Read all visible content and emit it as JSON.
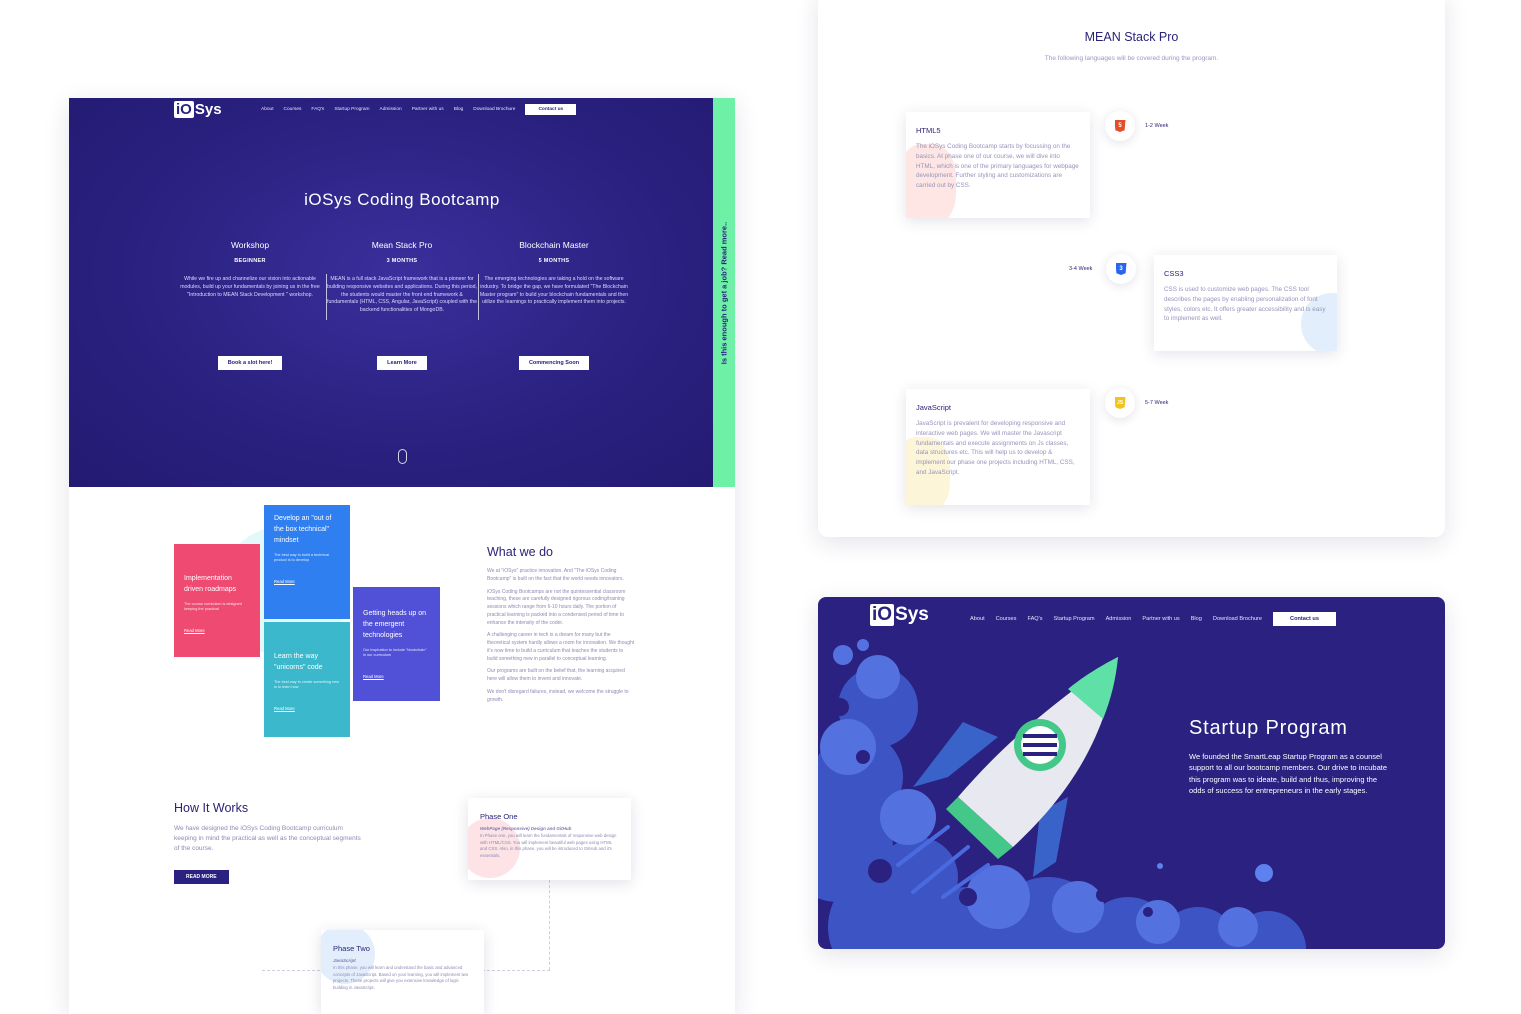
{
  "brand": {
    "logo_mark": "iO",
    "logo_rest": "Sys"
  },
  "nav": {
    "items": [
      "About",
      "Courses",
      "FAQ's",
      "Startup Program",
      "Admission",
      "Partner with us",
      "Blog",
      "Download Brochure"
    ],
    "contact_label": "Contact us"
  },
  "hero": {
    "title": "iOSys Coding Bootcamp",
    "side_tab": "Is this enough to get a job? Read more..",
    "programs": [
      {
        "name": "Workshop",
        "level": "BEGINNER",
        "description": "While we fire up and channelize our vision into actionable modules, build up your fundamentals by joining us in the free \"Introduction to MEAN Stack Development \" workshop.",
        "button": "Book a slot here!"
      },
      {
        "name": "Mean Stack Pro",
        "level": "3 MONTHS",
        "description": "MEAN is a full stack JavaScript framework that is a pioneer for building responsive websites and applications. During this period, the students would master the front end framework & fundamentals (HTML, CSS, Angular, JavaScript) coupled with the backend functionalities of MongoDB.",
        "button": "Learn More"
      },
      {
        "name": "Blockchain Master",
        "level": "5 MONTHS",
        "description": "The emerging technologies are taking a hold on the software industry. To bridge the gap, we have formulated \"The Blockchain Master program\" to build your blockchain fundamentals and then utilize the learnings to practically implement them into projects.",
        "button": "Commencing Soon"
      }
    ]
  },
  "cards": [
    {
      "title": "Implementation driven roadmaps",
      "text": "The course curriculum is designed keeping the practical",
      "link": "Read More",
      "color": "#ee4a72"
    },
    {
      "title": "Develop an \"out of the box technical\" mindset",
      "text": "The best way to build a technical product is to develop",
      "link": "Read More",
      "color": "#2f7ff0"
    },
    {
      "title": "Learn the way \"unicorns\" code",
      "text": "The best way to create something new is to learn how",
      "link": "Read More",
      "color": "#3bb8cc"
    },
    {
      "title": "Getting heads up on the emergent technologies",
      "text": "Our inspiration to include \"blockchain\" in our curriculum",
      "link": "Read More",
      "color": "#5151d8"
    }
  ],
  "what_we_do": {
    "title": "What we do",
    "paragraphs": [
      "We at \"iOSys\" practice innovation. And \"The iOSys Coding Bootcamp\" is built on the fact that the world needs innovators.",
      "iOSys Coding Bootcamps are not the quintessential classroom teaching, these are carefully designed rigorous coding/training sessions which range from 6-10 hours daily. The portion of practical learning is packed into a condensed period of time to enhance the intensity of the coder.",
      "A challenging career in tech is a dream for many but the theoretical system hardly allows a room for innovation. We thought it's now time to build a curriculum that teaches the students to build something new in parallel to conceptual learning.",
      "Our programs are built on the belief that, the learning acquired here will allow them to invent and innovate.",
      "We don't disregard failures, instead, we welcome the struggle to growth."
    ]
  },
  "how_it_works": {
    "title": "How It Works",
    "text": "We have designed the iOSys Coding Bootcamp curriculum keeping in mind the practical as well as the conceptual segments of the course.",
    "button": "READ MORE"
  },
  "phases": [
    {
      "title": "Phase One",
      "topic": "WebPage (Responsive) Design and GitHub",
      "text": "In Phase one, you will learn the fundamentals of responsive web design with HTML/CSS. You will implement beautiful web pages using HTML and CSS. Also, in this phase, you will be introduced to GitHub and it's essentials."
    },
    {
      "title": "Phase Two",
      "topic": "JavaScript",
      "text": "In this phase, you will learn and understand the basic and advanced concepts of JavaScript. Based on your learning, you will implement two projects. These projects will give you extensive knowledge of logic building in JavaScript."
    }
  ],
  "mean_stack": {
    "title": "MEAN Stack Pro",
    "subtitle": "The following languages will be covered during the program.",
    "languages": [
      {
        "name": "HTML5",
        "text": "The iOSys Coding Bootcamp starts by focussing on the basics. At phase one of our course, we will dive into HTML, which is one of the primary languages for webpage development. Further styling and customizations are carried out by CSS.",
        "duration": "1-2 Week",
        "icon": "html5-icon",
        "badge": "5",
        "color": "#e44d26"
      },
      {
        "name": "CSS3",
        "text": "CSS is used to customize web pages. The CSS tool describes the pages by enabling personalization of font styles, colors etc. It offers greater accessibility and is easy to implement as well.",
        "duration": "3-4 Week",
        "icon": "css3-icon",
        "badge": "3",
        "color": "#2965f1"
      },
      {
        "name": "JavaScript",
        "text": "JavaScript is prevalent for developing responsive and interactive web pages. We will master the Javascript fundamentals and execute assignments on Js classes, data structures etc. This will help us to develop & implement our phase one projects including HTML, CSS, and JavaScript.",
        "duration": "5-7 Week",
        "icon": "javascript-icon",
        "badge": "JS",
        "color": "#f0c419"
      }
    ]
  },
  "startup": {
    "title": "Startup Program",
    "text": "We founded the SmartLeap Startup Program as a counsel support to all our bootcamp members. Our drive to incubate this program was to ideate, build and thus, improving the odds of success for entrepreneurs in the early stages."
  },
  "colors": {
    "primary": "#2a2180",
    "accent_green": "#6ef0a6",
    "text_muted": "#8d8ab5"
  }
}
